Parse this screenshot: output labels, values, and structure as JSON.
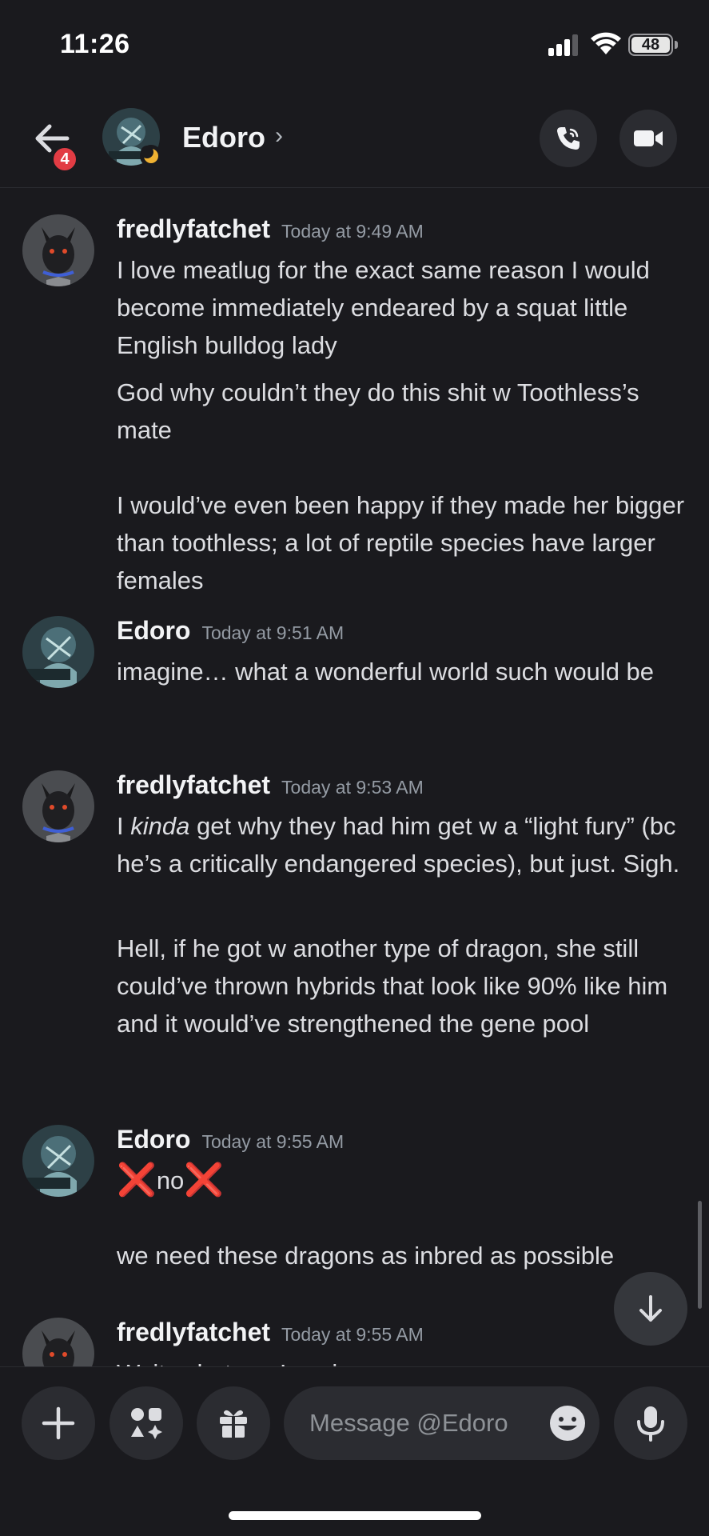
{
  "status_bar": {
    "time": "11:26",
    "battery": "48"
  },
  "header": {
    "unread_count": "4",
    "contact_name": "Edoro",
    "chevron": "›"
  },
  "messages": [
    {
      "author": "fredlyfatchet",
      "timestamp": "Today at 9:49 AM",
      "lines": [
        "I love meatlug for the exact same reason I would become immediately endeared by a squat little English bulldog lady",
        "God why couldn’t they do this shit w Toothless’s mate",
        "I would’ve even been happy if they made her bigger than toothless; a lot of reptile species have larger females"
      ]
    },
    {
      "author": "Edoro",
      "timestamp": "Today at 9:51 AM",
      "lines": [
        "imagine… what a wonderful world such would be"
      ]
    },
    {
      "author": "fredlyfatchet",
      "timestamp": "Today at 9:53 AM",
      "lines_rich": {
        "prefix": "I ",
        "emphasis": "kinda",
        "suffix": " get why they had him get w a “light fury” (bc he’s a critically endangered species), but just. Sigh."
      },
      "lines": [
        "Hell, if he got w another type of dragon, she still could’ve thrown hybrids that look like 90% like him and it would’ve strengthened the gene pool"
      ]
    },
    {
      "author": "Edoro",
      "timestamp": "Today at 9:55 AM",
      "cross_symbol": "❌",
      "inline_word": "no",
      "lines": [
        "we need these dragons as inbred as possible"
      ]
    },
    {
      "author": "fredlyfatchet",
      "timestamp": "Today at 9:55 AM",
      "lines": [
        "Wait, what am I saying"
      ]
    }
  ],
  "composer": {
    "placeholder": "Message @Edoro"
  },
  "colors": {
    "background": "#1a1a1e",
    "badge": "#e23c44",
    "moon": "#f0b232",
    "cross": "#e32828"
  },
  "icons": [
    "back-arrow-icon",
    "phone-icon",
    "video-camera-icon",
    "plus-icon",
    "apps-icon",
    "gift-icon",
    "emoji-icon",
    "microphone-icon",
    "arrow-down-icon"
  ]
}
